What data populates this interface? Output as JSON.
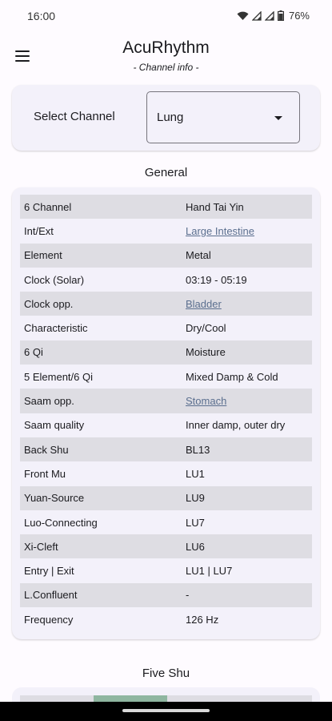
{
  "status": {
    "time": "16:00",
    "battery": "76%"
  },
  "app": {
    "title": "AcuRhythm",
    "subtitle": "- Channel info -"
  },
  "selector": {
    "label": "Select Channel",
    "value": "Lung"
  },
  "general": {
    "title": "General",
    "rows": [
      {
        "key": "6 Channel",
        "value": "Hand Tai Yin",
        "link": false
      },
      {
        "key": "Int/Ext",
        "value": "Large Intestine",
        "link": true
      },
      {
        "key": "Element",
        "value": "Metal",
        "link": false
      },
      {
        "key": "Clock (Solar)",
        "value": "03:19 - 05:19",
        "link": false
      },
      {
        "key": "Clock opp.",
        "value": "Bladder",
        "link": true
      },
      {
        "key": "Characteristic",
        "value": "Dry/Cool",
        "link": false
      },
      {
        "key": "6 Qi",
        "value": "Moisture",
        "link": false
      },
      {
        "key": "5 Element/6 Qi",
        "value": "Mixed Damp & Cold",
        "link": false
      },
      {
        "key": "Saam opp.",
        "value": "Stomach",
        "link": true
      },
      {
        "key": "Saam quality",
        "value": "Inner damp, outer dry",
        "link": false
      },
      {
        "key": "Back Shu",
        "value": "BL13",
        "link": false
      },
      {
        "key": "Front Mu",
        "value": "LU1",
        "link": false
      },
      {
        "key": "Yuan-Source",
        "value": "LU9",
        "link": false
      },
      {
        "key": "Luo-Connecting",
        "value": "LU7",
        "link": false
      },
      {
        "key": "Xi-Cleft",
        "value": "LU6",
        "link": false
      },
      {
        "key": "Entry | Exit",
        "value": "LU1 | LU7",
        "link": false
      },
      {
        "key": "L.Confluent",
        "value": "-",
        "link": false
      },
      {
        "key": "Frequency",
        "value": "126 Hz",
        "link": false
      }
    ]
  },
  "five_shu": {
    "title": "Five Shu"
  },
  "colors": {
    "link": "#5b6f8f",
    "card": "#f3f1fa",
    "row_shade": "#dedde3",
    "accent_green": "#8fb6a0"
  }
}
